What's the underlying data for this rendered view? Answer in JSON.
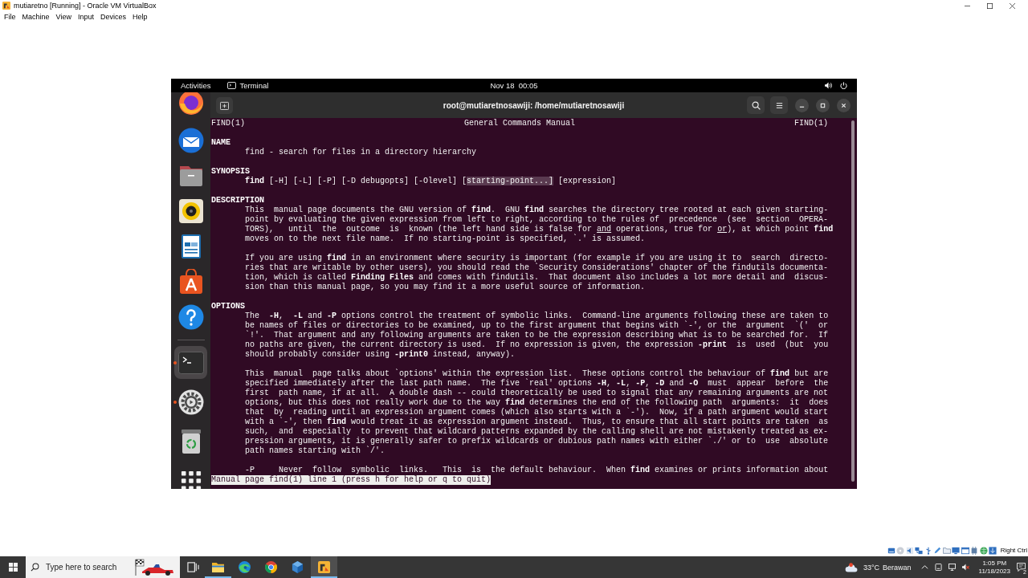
{
  "window": {
    "title": "mutiaretno [Running] - Oracle VM VirtualBox",
    "menu": [
      "File",
      "Machine",
      "View",
      "Input",
      "Devices",
      "Help"
    ]
  },
  "guest": {
    "top_bar": {
      "activities": "Activities",
      "app_name": "Terminal",
      "clock": "Nov 18  00:05"
    },
    "dock": {
      "pinned": [
        {
          "kind": "browser",
          "running": false,
          "selected": false
        },
        {
          "kind": "mail",
          "running": false,
          "selected": false
        },
        {
          "kind": "files",
          "running": false,
          "selected": false
        },
        {
          "kind": "music",
          "running": false,
          "selected": false
        },
        {
          "kind": "writer",
          "running": false,
          "selected": false
        },
        {
          "kind": "store",
          "running": false,
          "selected": false
        },
        {
          "kind": "help",
          "running": false,
          "selected": false
        }
      ],
      "others": [
        {
          "kind": "terminal",
          "running": true,
          "selected": true
        },
        {
          "kind": "settings",
          "running": true,
          "selected": false
        },
        {
          "kind": "trash",
          "running": false,
          "selected": false
        },
        {
          "kind": "apps",
          "running": false,
          "selected": false
        }
      ]
    },
    "terminal": {
      "title": "root@mutiaretnosawiji: /home/mutiaretnosawiji",
      "man_page": {
        "header": {
          "left": "FIND(1)",
          "center": "General Commands Manual",
          "right": "FIND(1)"
        },
        "sections": [
          {
            "heading": "NAME",
            "paragraphs": [
              [
                {
                  "text": "find - search for files in a directory hierarchy"
                }
              ]
            ]
          },
          {
            "heading": "SYNOPSIS",
            "paragraphs": [
              [
                {
                  "text": "**find** [-H] [-L] [-P] [-D debugopts] [-Olevel] [",
                  "selected_text": "starting-point...]",
                  "text_after": " [expression]"
                }
              ]
            ]
          },
          {
            "heading": "DESCRIPTION",
            "paragraphs": [
              [
                {
                  "text": "This  manual page documents the GNU version of **find**.  GNU **find** searches the directory tree rooted at each given starting-"
                },
                {
                  "text": "point by evaluating the given expression from left to right, according to the rules of  precedence  (see  section  OPERA-"
                },
                {
                  "text": "TORS),   until  the  outcome  is  known (the left hand side is false for *and* operations, true for *or*), at which point **find**"
                },
                {
                  "text": "moves on to the next file name.  If no starting-point is specified, `.' is assumed."
                }
              ],
              [
                {
                  "text": "If you are using **find** in an environment where security is important (for example if you are using it to  search  directo-"
                },
                {
                  "text": "ries that are writable by other users), you should read the `Security Considerations' chapter of the findutils documenta-"
                },
                {
                  "text": "tion, which is called **Finding Files** and comes with findutils.  That document also includes a lot more detail and  discus-"
                },
                {
                  "text": "sion than this manual page, so you may find it a more useful source of information."
                }
              ]
            ]
          },
          {
            "heading": "OPTIONS",
            "paragraphs": [
              [
                {
                  "text": "The  **-H**,  **-L** and **-P** options control the treatment of symbolic links.  Command-line arguments following these are taken to"
                },
                {
                  "text": "be names of files or directories to be examined, up to the first argument that begins with `-', or the  argument  `('  or"
                },
                {
                  "text": "`!'.  That argument and any following arguments are taken to be the expression describing what is to be searched for.  If"
                },
                {
                  "text": "no paths are given, the current directory is used.  If no expression is given, the expression **-print**  is  used  (but  you"
                },
                {
                  "text": "should probably consider using **-print0** instead, anyway)."
                }
              ],
              [
                {
                  "text": "This  manual  page talks about `options' within the expression list.  These options control the behaviour of **find** but are"
                },
                {
                  "text": "specified immediately after the last path name.  The five `real' options **-H**, **-L**, **-P**, **-D** and **-O**  must  appear  before  the"
                },
                {
                  "text": "first  path name, if at all.  A double dash -- could theoretically be used to signal that any remaining arguments are not"
                },
                {
                  "text": "options, but this does not really work due to the way **find** determines the end of the following path  arguments:  it  does"
                },
                {
                  "text": "that  by  reading until an expression argument comes (which also starts with a `-').  Now, if a path argument would start"
                },
                {
                  "text": "with a `-', then **find** would treat it as expression argument instead.  Thus, to ensure that all start points are taken  as"
                },
                {
                  "text": "such,  and  especially  to prevent that wildcard patterns expanded by the calling shell are not mistakenly treated as ex-"
                },
                {
                  "text": "pression arguments, it is generally safer to prefix wildcards or dubious path names with either `./' or to  use  absolute"
                },
                {
                  "text": "path names starting with `/'."
                }
              ],
              [
                {
                  "text": "-P     Never  follow  symbolic  links.   This  is  the default behaviour.  When **find** examines or prints information about"
                }
              ]
            ]
          }
        ]
      },
      "pager_status": "Manual page find(1) line 1 (press h for help or q to quit)"
    }
  },
  "vm_status_bar": {
    "host_key": "Right Ctrl"
  },
  "taskbar": {
    "search": {
      "placeholder": "Type here to search"
    },
    "apps": [
      {
        "kind": "task-view",
        "running": false,
        "selected": false
      },
      {
        "kind": "explorer",
        "running": true,
        "selected": false
      },
      {
        "kind": "edge",
        "running": false,
        "selected": false
      },
      {
        "kind": "chrome",
        "running": false,
        "selected": false
      },
      {
        "kind": "virtualbox",
        "running": false,
        "selected": false
      },
      {
        "kind": "vm-window",
        "running": true,
        "selected": true
      }
    ],
    "weather": {
      "temperature": "33°C",
      "condition": "Berawan"
    },
    "time": "1:05 PM",
    "date": "11/18/2023",
    "notification_count": "2"
  }
}
